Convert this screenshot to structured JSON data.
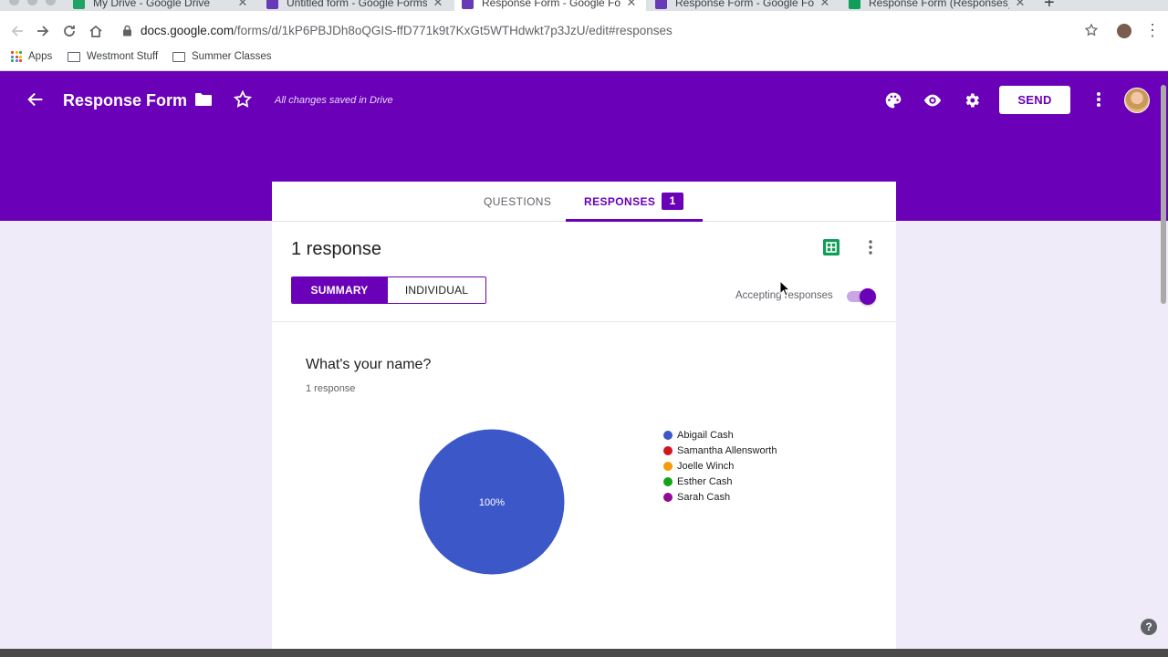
{
  "browser": {
    "tabs": [
      {
        "title": "My Drive - Google Drive",
        "favicon_color": "#1fa463"
      },
      {
        "title": "Untitled form - Google Forms",
        "favicon_color": "#673ab7"
      },
      {
        "title": "Response Form - Google Form",
        "favicon_color": "#673ab7",
        "active": true
      },
      {
        "title": "Response Form - Google Form",
        "favicon_color": "#673ab7"
      },
      {
        "title": "Response Form (Responses) -",
        "favicon_color": "#0f9d58"
      }
    ],
    "url_domain": "docs.google.com",
    "url_path": "/forms/d/1kP6PBJDh8oQGIS-ffD771k9t7KxGt5WTHdwkt7p3JzU/edit#responses",
    "bookmarks": [
      "Apps",
      "Westmont Stuff",
      "Summer Classes"
    ]
  },
  "header": {
    "title": "Response Form",
    "saved_status": "All changes saved in Drive",
    "send_label": "SEND",
    "color": "#6a00b8"
  },
  "form": {
    "tab_questions": "QUESTIONS",
    "tab_responses": "RESPONSES",
    "responses_badge": "1",
    "response_count": "1 response",
    "summary_label": "SUMMARY",
    "individual_label": "INDIVIDUAL",
    "accepting_label": "Accepting responses",
    "accepting": true
  },
  "question": {
    "title": "What's your name?",
    "responses": "1 response"
  },
  "chart_data": {
    "type": "pie",
    "slice_label": "100%",
    "values": [
      1,
      0,
      0,
      0,
      0
    ],
    "legend": [
      {
        "name": "Abigail Cash",
        "color": "#3b57c8"
      },
      {
        "name": "Samantha Allensworth",
        "color": "#d0161f"
      },
      {
        "name": "Joelle Winch",
        "color": "#f19c09"
      },
      {
        "name": "Esther Cash",
        "color": "#16a31a"
      },
      {
        "name": "Sarah Cash",
        "color": "#900c91"
      }
    ]
  },
  "help_label": "?"
}
